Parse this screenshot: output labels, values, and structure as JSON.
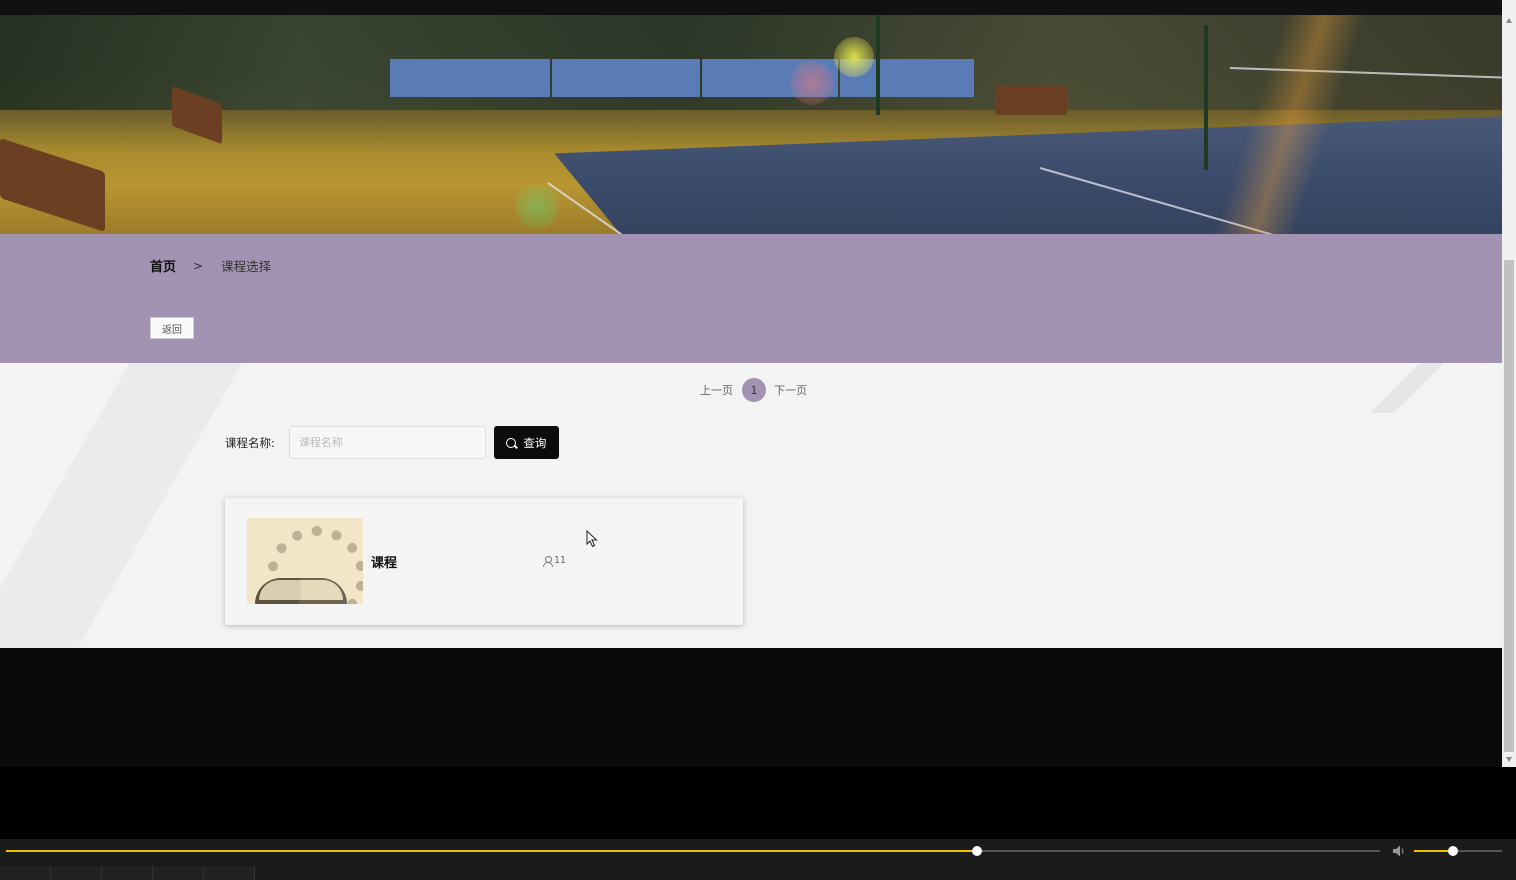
{
  "breadcrumb": {
    "home": "首页",
    "separator": ">",
    "current": "课程选择"
  },
  "back_button": "返回",
  "pagination": {
    "prev": "上一页",
    "current_page": "1",
    "next": "下一页"
  },
  "search": {
    "label": "课程名称:",
    "placeholder": "课程名称",
    "value": "",
    "button": "查询"
  },
  "courses": [
    {
      "title": "课程",
      "count": "11",
      "thumbnail_icon": "open-book-image"
    }
  ],
  "colors": {
    "accent": "#a293b3",
    "search_button": "#0c0c0c",
    "progress": "#f2c200"
  },
  "player": {
    "progress": 0.707,
    "volume": 0.44
  }
}
